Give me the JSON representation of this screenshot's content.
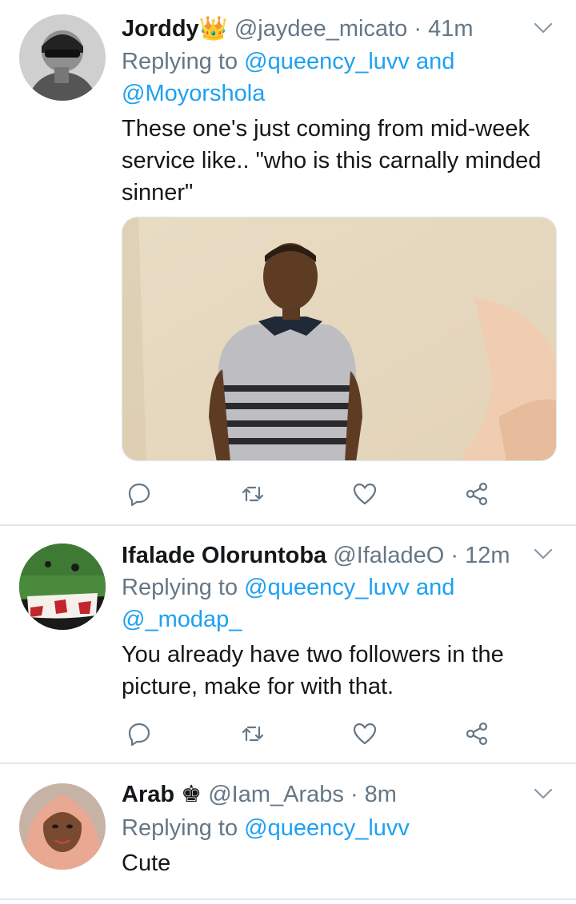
{
  "tweets": [
    {
      "name": "Jorddy",
      "name_emoji": "👑",
      "handle": "@jaydee_micato",
      "separator": "·",
      "time": "41m",
      "reply_prefix": "Replying to",
      "reply_mention_1": "@queency_luvv",
      "reply_and": "and",
      "reply_mention_2": "@Moyorshola",
      "text": "These one's just coming from mid-week service like.. \"who is this carnally minded sinner\""
    },
    {
      "name": "Ifalade Oloruntoba",
      "handle": "@IfaladeO",
      "separator": "·",
      "time": "12m",
      "reply_prefix": "Replying to",
      "reply_mention_1": "@queency_luvv",
      "reply_and": "and",
      "reply_mention_2": "@_modap_",
      "text": "You already have two followers in the picture, make for with that."
    },
    {
      "name": "Arab",
      "name_emoji": "♚",
      "handle": "@Iam_Arabs",
      "separator": "·",
      "time": "8m",
      "reply_prefix": "Replying to",
      "reply_mention_1": "@queency_luvv",
      "text": "Cute"
    }
  ],
  "icons": {
    "reply": "reply-icon",
    "retweet": "retweet-icon",
    "like": "heart-icon",
    "share": "share-icon",
    "menu": "chevron-down-icon"
  },
  "colors": {
    "link": "#1da1f2",
    "secondary_text": "#657786",
    "primary_text": "#14171a",
    "divider": "#e1e8ed"
  }
}
